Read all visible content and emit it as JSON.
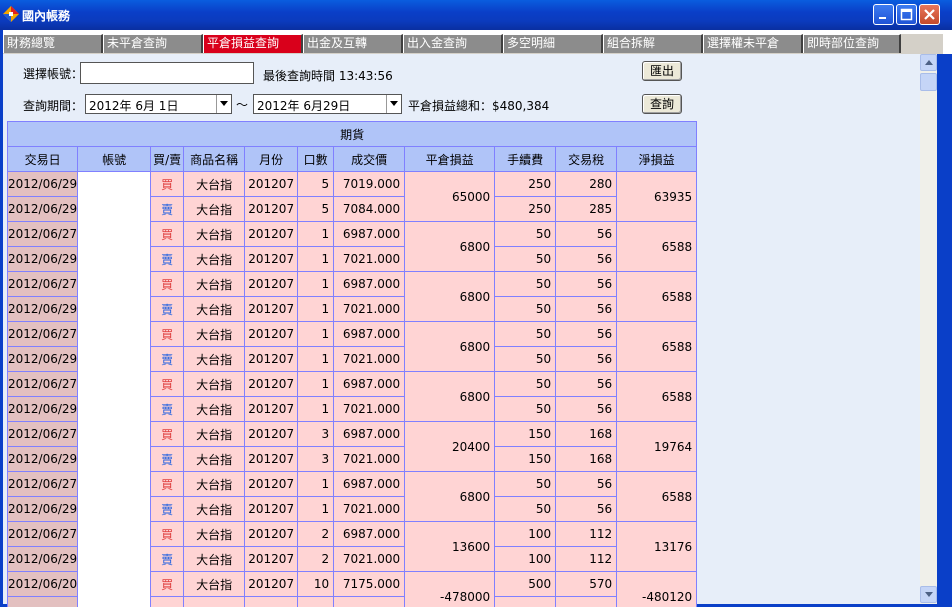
{
  "window": {
    "title": "國內帳務"
  },
  "tabs": [
    {
      "label": "財務總覽",
      "active": false
    },
    {
      "label": "未平倉查詢",
      "active": false
    },
    {
      "label": "平倉損益查詢",
      "active": true
    },
    {
      "label": "出金及互轉",
      "active": false
    },
    {
      "label": "出入金查詢",
      "active": false
    },
    {
      "label": "多空明細",
      "active": false
    },
    {
      "label": "組合拆解",
      "active": false
    },
    {
      "label": "選擇權未平倉",
      "active": false
    },
    {
      "label": "即時部位查詢",
      "active": false
    }
  ],
  "form": {
    "account_label": "選擇帳號：",
    "account_value": "",
    "last_query_label": "最後查詢時間",
    "last_query_time": "13:43:56",
    "period_label": "查詢期間：",
    "start_date": "2012年  6月  1日",
    "tilde": "～",
    "end_date": "2012年  6月29日",
    "total_label": "平倉損益總和：",
    "total_value": "$480,384",
    "export_button": "匯出",
    "query_button": "查詢"
  },
  "table": {
    "group_header": "期貨",
    "columns": [
      "交易日",
      "帳號",
      "買/賣",
      "商品名稱",
      "月份",
      "口數",
      "成交價",
      "平倉損益",
      "手續費",
      "交易稅",
      "淨損益"
    ],
    "pairs": [
      {
        "pl": "65000",
        "net": "63935",
        "rows": [
          {
            "date": "2012/06/29",
            "bs": "買",
            "side": "buy",
            "name": "大台指",
            "month": "201207",
            "lots": "5",
            "price": "7019.000",
            "fee": "250",
            "tax": "280"
          },
          {
            "date": "2012/06/29",
            "bs": "賣",
            "side": "sell",
            "name": "大台指",
            "month": "201207",
            "lots": "5",
            "price": "7084.000",
            "fee": "250",
            "tax": "285"
          }
        ]
      },
      {
        "pl": "6800",
        "net": "6588",
        "rows": [
          {
            "date": "2012/06/27",
            "bs": "買",
            "side": "buy",
            "name": "大台指",
            "month": "201207",
            "lots": "1",
            "price": "6987.000",
            "fee": "50",
            "tax": "56"
          },
          {
            "date": "2012/06/29",
            "bs": "賣",
            "side": "sell",
            "name": "大台指",
            "month": "201207",
            "lots": "1",
            "price": "7021.000",
            "fee": "50",
            "tax": "56"
          }
        ]
      },
      {
        "pl": "6800",
        "net": "6588",
        "rows": [
          {
            "date": "2012/06/27",
            "bs": "買",
            "side": "buy",
            "name": "大台指",
            "month": "201207",
            "lots": "1",
            "price": "6987.000",
            "fee": "50",
            "tax": "56"
          },
          {
            "date": "2012/06/29",
            "bs": "賣",
            "side": "sell",
            "name": "大台指",
            "month": "201207",
            "lots": "1",
            "price": "7021.000",
            "fee": "50",
            "tax": "56"
          }
        ]
      },
      {
        "pl": "6800",
        "net": "6588",
        "rows": [
          {
            "date": "2012/06/27",
            "bs": "買",
            "side": "buy",
            "name": "大台指",
            "month": "201207",
            "lots": "1",
            "price": "6987.000",
            "fee": "50",
            "tax": "56"
          },
          {
            "date": "2012/06/29",
            "bs": "賣",
            "side": "sell",
            "name": "大台指",
            "month": "201207",
            "lots": "1",
            "price": "7021.000",
            "fee": "50",
            "tax": "56"
          }
        ]
      },
      {
        "pl": "6800",
        "net": "6588",
        "rows": [
          {
            "date": "2012/06/27",
            "bs": "買",
            "side": "buy",
            "name": "大台指",
            "month": "201207",
            "lots": "1",
            "price": "6987.000",
            "fee": "50",
            "tax": "56"
          },
          {
            "date": "2012/06/29",
            "bs": "賣",
            "side": "sell",
            "name": "大台指",
            "month": "201207",
            "lots": "1",
            "price": "7021.000",
            "fee": "50",
            "tax": "56"
          }
        ]
      },
      {
        "pl": "20400",
        "net": "19764",
        "rows": [
          {
            "date": "2012/06/27",
            "bs": "買",
            "side": "buy",
            "name": "大台指",
            "month": "201207",
            "lots": "3",
            "price": "6987.000",
            "fee": "150",
            "tax": "168"
          },
          {
            "date": "2012/06/29",
            "bs": "賣",
            "side": "sell",
            "name": "大台指",
            "month": "201207",
            "lots": "3",
            "price": "7021.000",
            "fee": "150",
            "tax": "168"
          }
        ]
      },
      {
        "pl": "6800",
        "net": "6588",
        "rows": [
          {
            "date": "2012/06/27",
            "bs": "買",
            "side": "buy",
            "name": "大台指",
            "month": "201207",
            "lots": "1",
            "price": "6987.000",
            "fee": "50",
            "tax": "56"
          },
          {
            "date": "2012/06/29",
            "bs": "賣",
            "side": "sell",
            "name": "大台指",
            "month": "201207",
            "lots": "1",
            "price": "7021.000",
            "fee": "50",
            "tax": "56"
          }
        ]
      },
      {
        "pl": "13600",
        "net": "13176",
        "rows": [
          {
            "date": "2012/06/27",
            "bs": "買",
            "side": "buy",
            "name": "大台指",
            "month": "201207",
            "lots": "2",
            "price": "6987.000",
            "fee": "100",
            "tax": "112"
          },
          {
            "date": "2012/06/29",
            "bs": "賣",
            "side": "sell",
            "name": "大台指",
            "month": "201207",
            "lots": "2",
            "price": "7021.000",
            "fee": "100",
            "tax": "112"
          }
        ]
      },
      {
        "pl": "-478000",
        "net": "-480120",
        "rows": [
          {
            "date": "2012/06/20",
            "bs": "買",
            "side": "buy",
            "name": "大台指",
            "month": "201207",
            "lots": "10",
            "price": "7175.000",
            "fee": "500",
            "tax": "570"
          },
          {
            "date": "",
            "bs": "",
            "side": "sell",
            "name": "",
            "month": "",
            "lots": "",
            "price": "",
            "fee": "",
            "tax": ""
          }
        ]
      }
    ]
  }
}
